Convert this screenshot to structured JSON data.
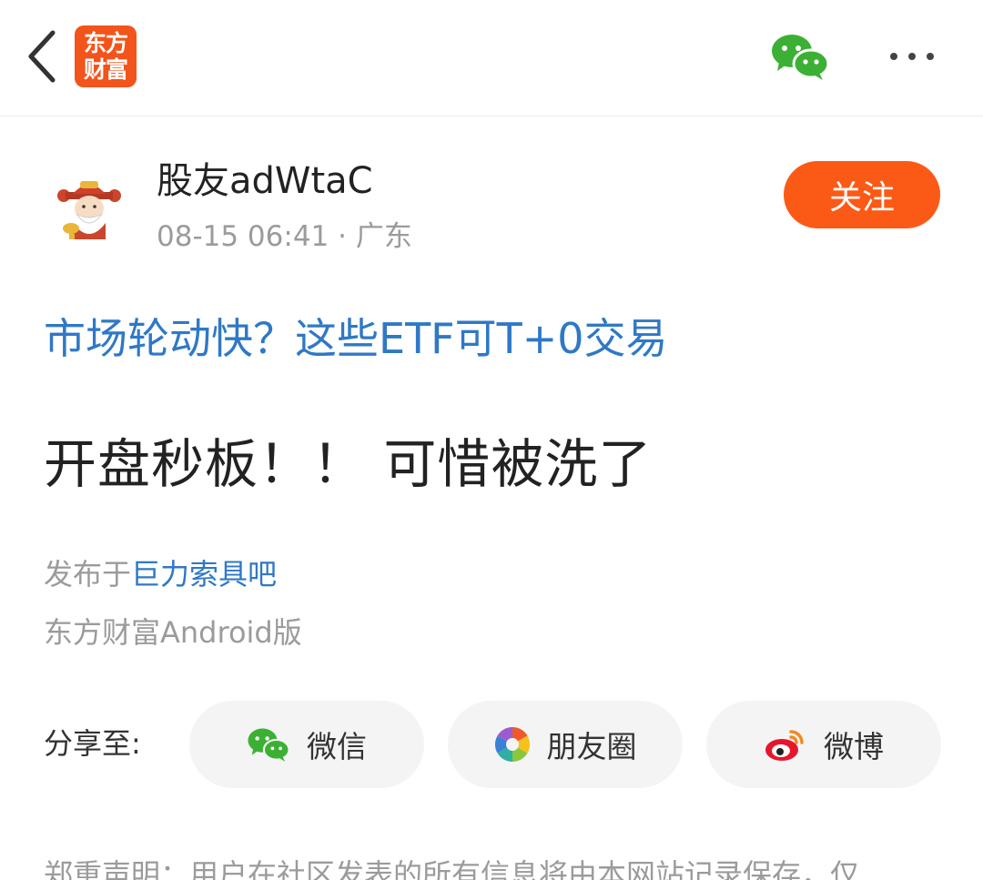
{
  "header": {
    "back_icon": "chevron-left-icon",
    "logo_line1": "东方",
    "logo_line2": "财富",
    "share_icon": "wechat-icon",
    "more_icon": "more-horizontal-icon",
    "brand_color": "#f2541b"
  },
  "post": {
    "author": "股友adWtaC",
    "meta": "08-15 06:41 · 广东",
    "follow_label": "关注",
    "headline_link": "市场轮动快？这些ETF可T+0交易",
    "content": "开盘秒板！！ 可惜被洗了",
    "published_prefix": "发布于",
    "published_bar": "巨力索具吧",
    "source": "东方财富Android版"
  },
  "share": {
    "label": "分享至:",
    "buttons": [
      {
        "label": "微信",
        "icon": "wechat-icon"
      },
      {
        "label": "朋友圈",
        "icon": "moments-icon"
      },
      {
        "label": "微博",
        "icon": "weibo-icon"
      }
    ]
  },
  "footer": {
    "disclaimer": "郑重声明：用户在社区发表的所有信息将由本网站记录保存，仅"
  },
  "colors": {
    "follow_button": "#fb5a16",
    "link": "#2f78c6",
    "wechat_green": "#3cb034"
  }
}
